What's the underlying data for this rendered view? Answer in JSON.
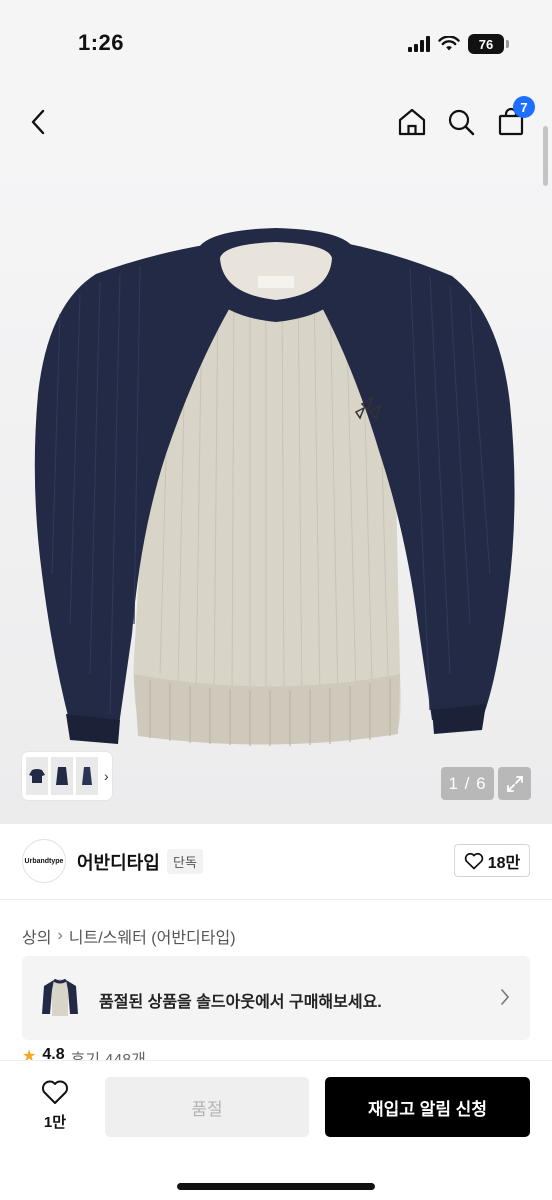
{
  "status_bar": {
    "time": "1:26",
    "battery": "76"
  },
  "header": {
    "cart_count": "7"
  },
  "gallery": {
    "counter": "1 / 6"
  },
  "brand": {
    "logo_text": "Urbandtype",
    "name": "어반디타입",
    "exclusive_badge": "단독",
    "like_count": "18만"
  },
  "breadcrumb": [
    "상의",
    "니트/스웨터 (어반디타입)"
  ],
  "soldout_banner": {
    "text": "품절된 상품을 솔드아웃에서 구매해보세요."
  },
  "rating": {
    "value": "4.8",
    "reviews_label": "후기 448개"
  },
  "bottom_bar": {
    "like_count": "1만",
    "soldout_label": "품절",
    "restock_label": "재입고 알림 신청"
  },
  "colors": {
    "navy": "#222a45",
    "beige": "#d9d4c8",
    "badge_blue": "#1e6fff"
  }
}
